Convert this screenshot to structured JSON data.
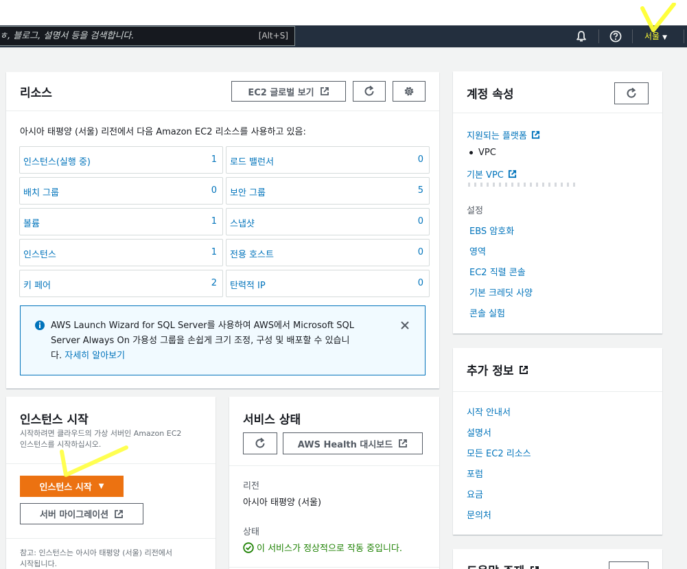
{
  "nav": {
    "search_placeholder": "ㅎ, 블로그, 설명서 등을 검색합니다.",
    "search_shortcut": "[Alt+S]",
    "region_label": "서울",
    "region_caret": "▼"
  },
  "resources": {
    "title": "리소스",
    "global_view_button": "EC2 글로벌 보기",
    "description": "아시아 태평양 (서울) 리전에서 다음 Amazon EC2 리소스를 사용하고 있음:",
    "items": [
      {
        "label": "인스턴스(실행 중)",
        "count": "1"
      },
      {
        "label": "로드 밸런서",
        "count": "0"
      },
      {
        "label": "배치 그룹",
        "count": "0"
      },
      {
        "label": "보안 그룹",
        "count": "5"
      },
      {
        "label": "볼륨",
        "count": "1"
      },
      {
        "label": "스냅샷",
        "count": "0"
      },
      {
        "label": "인스턴스",
        "count": "1"
      },
      {
        "label": "전용 호스트",
        "count": "0"
      },
      {
        "label": "키 페어",
        "count": "2"
      },
      {
        "label": "탄력적 IP",
        "count": "0"
      }
    ],
    "alert": {
      "line1": "AWS Launch Wizard for SQL Server를 사용하여 AWS에서 Microsoft SQL",
      "line2": "Server Always On 가용성 그룹을 손쉽게 크기 조정, 구성 및 배포할 수 있습니",
      "line3_prefix": "다. ",
      "link": "자세히 알아보기"
    }
  },
  "launch": {
    "title": "인스턴스 시작",
    "desc_line1": "시작하려면 클라우드의 가상 서버인 Amazon EC2",
    "desc_line2": "인스턴스를 시작하십시오.",
    "launch_button": "인스턴스 시작",
    "launch_caret": "▼",
    "migration_button": "서버 마이그레이션",
    "note_line1": "참고: 인스턴스는 아시아 태평양 (서울) 리전에서",
    "note_line2": "시작됩니다."
  },
  "service_health": {
    "title": "서비스 상태",
    "health_button": "AWS Health 대시보드",
    "region_label": "리전",
    "region_value": "아시아 태평양 (서울)",
    "status_label": "상태",
    "status_value": "이 서비스가 정상적으로 작동 중입니다."
  },
  "account": {
    "title": "계정 속성",
    "platforms_link": "지원되는 플랫폼",
    "platform_item": "VPC",
    "default_vpc_link": "기본 VPC",
    "settings_label": "설정",
    "settings_links": [
      "EBS 암호화",
      "영역",
      "EC2 직렬 콘솔",
      "기본 크레딧 사양",
      "콘솔 실험"
    ]
  },
  "more_info": {
    "title": "추가 정보",
    "links": [
      "시작 안내서",
      "설명서",
      "모든 EC2 리소스",
      "포럼",
      "요금",
      "문의처"
    ]
  },
  "help_panel": {
    "title": "도움말 주제"
  },
  "colors": {
    "nav_bg": "#232f3e",
    "link": "#0073bb",
    "primary": "#ec7211",
    "success": "#1d8102",
    "info_bg": "#f1faff",
    "highlight": "#ffff33"
  }
}
